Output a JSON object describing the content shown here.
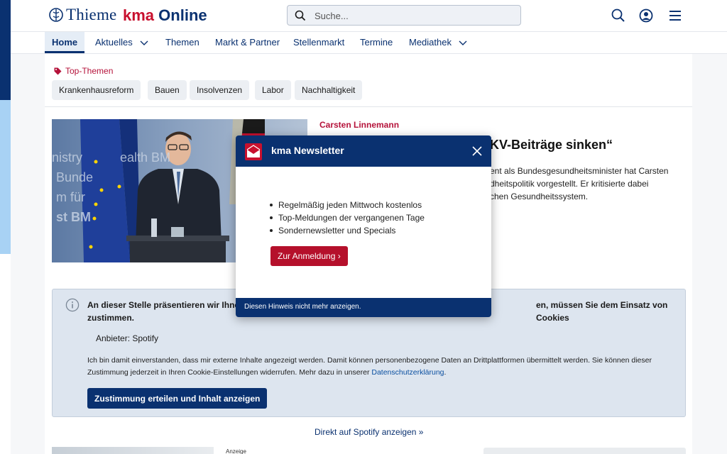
{
  "header": {
    "logo_thieme": "Thieme",
    "logo_kma_a": "kma",
    "logo_kma_b": "Online",
    "search_placeholder": "Suche..."
  },
  "nav": {
    "items": [
      {
        "label": "Home",
        "active": true
      },
      {
        "label": "Aktuelles",
        "dropdown": true
      },
      {
        "label": "Themen"
      },
      {
        "label": "Markt & Partner"
      },
      {
        "label": "Stellenmarkt"
      },
      {
        "label": "Termine"
      },
      {
        "label": "Mediathek",
        "dropdown": true
      }
    ]
  },
  "top_themen": {
    "label": "Top-Themen",
    "chips": [
      "Krankenhausreform",
      "Bauen",
      "Insolvenzen",
      "Labor",
      "Nachhaltigkeit"
    ]
  },
  "article": {
    "kicker": "Carsten Linnemann",
    "title": "KV-Beiträge sinken“",
    "text_lines": [
      "ent als Bundesgesundheitsminister hat Carsten",
      "dheitspolitik vorgestellt. Er kritisierte dabei",
      "chen Gesundheitssystem."
    ]
  },
  "cookie_box": {
    "head_left": "An dieser Stelle präsentieren wir Ihnen",
    "head_right": "en, müssen Sie dem Einsatz von Cookies",
    "head_line2": "zustimmen.",
    "anbieter": "Anbieter: Spotify",
    "consent_line1": "Ich bin damit einverstanden, dass mir externe Inhalte angezeigt werden. Damit können personenbezogene Daten an Drittplattformen übermittelt werden. Sie können dieser",
    "consent_line2_pre": "Zustimmung jederzeit in Ihren Cookie-Einstellungen widerrufen. Mehr dazu in unserer ",
    "consent_link": "Datenschutzerklärung",
    "consent_line2_post": ".",
    "button": "Zustimmung erteilen und Inhalt anzeigen"
  },
  "spotify_link": "Direkt auf Spotify anzeigen »",
  "anzeige": "Anzeige",
  "modal": {
    "title": "kma Newsletter",
    "bullets": [
      "Regelmäßig jeden Mittwoch kostenlos",
      "Top-Meldungen der vergangenen Tage",
      "Sondernewsletter und Specials"
    ],
    "button": "Zur Anmeldung",
    "footer": "Diesen Hinweis nicht mehr anzeigen."
  },
  "colors": {
    "brand_navy": "#0a3170",
    "brand_red": "#c8102e",
    "accent_light_blue": "#a8d2f4"
  }
}
